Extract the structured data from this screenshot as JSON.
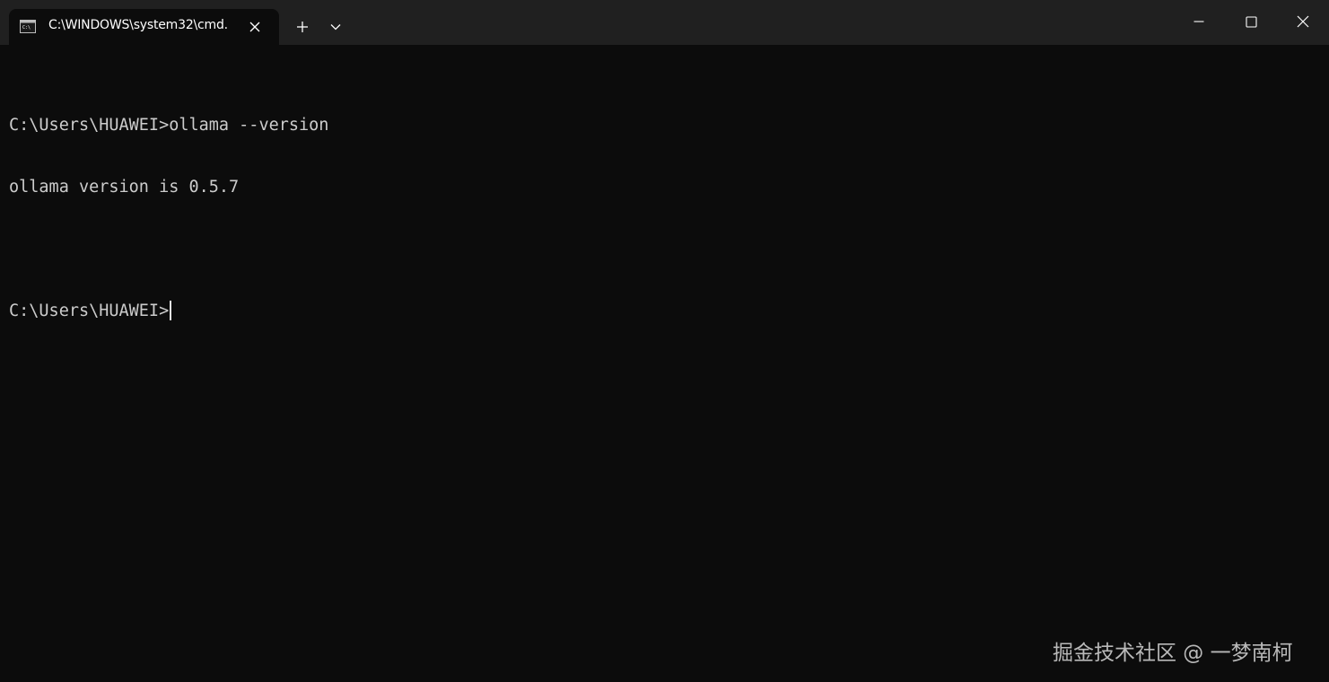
{
  "window": {
    "tab_title": "C:\\WINDOWS\\system32\\cmd.",
    "tab_icon": "cmd-icon",
    "close_tab_icon": "close-icon",
    "new_tab_icon": "plus-icon",
    "dropdown_icon": "chevron-down-icon",
    "minimize_icon": "minimize-icon",
    "maximize_icon": "maximize-icon",
    "close_window_icon": "close-icon"
  },
  "terminal": {
    "lines": [
      "",
      "C:\\Users\\HUAWEI>ollama --version",
      "ollama version is 0.5.7",
      "",
      "C:\\Users\\HUAWEI>"
    ]
  },
  "watermark": "掘金技术社区 @ 一梦南柯",
  "colors": {
    "background": "#0c0c0c",
    "titlebar": "#202020",
    "text": "#cccccc"
  }
}
